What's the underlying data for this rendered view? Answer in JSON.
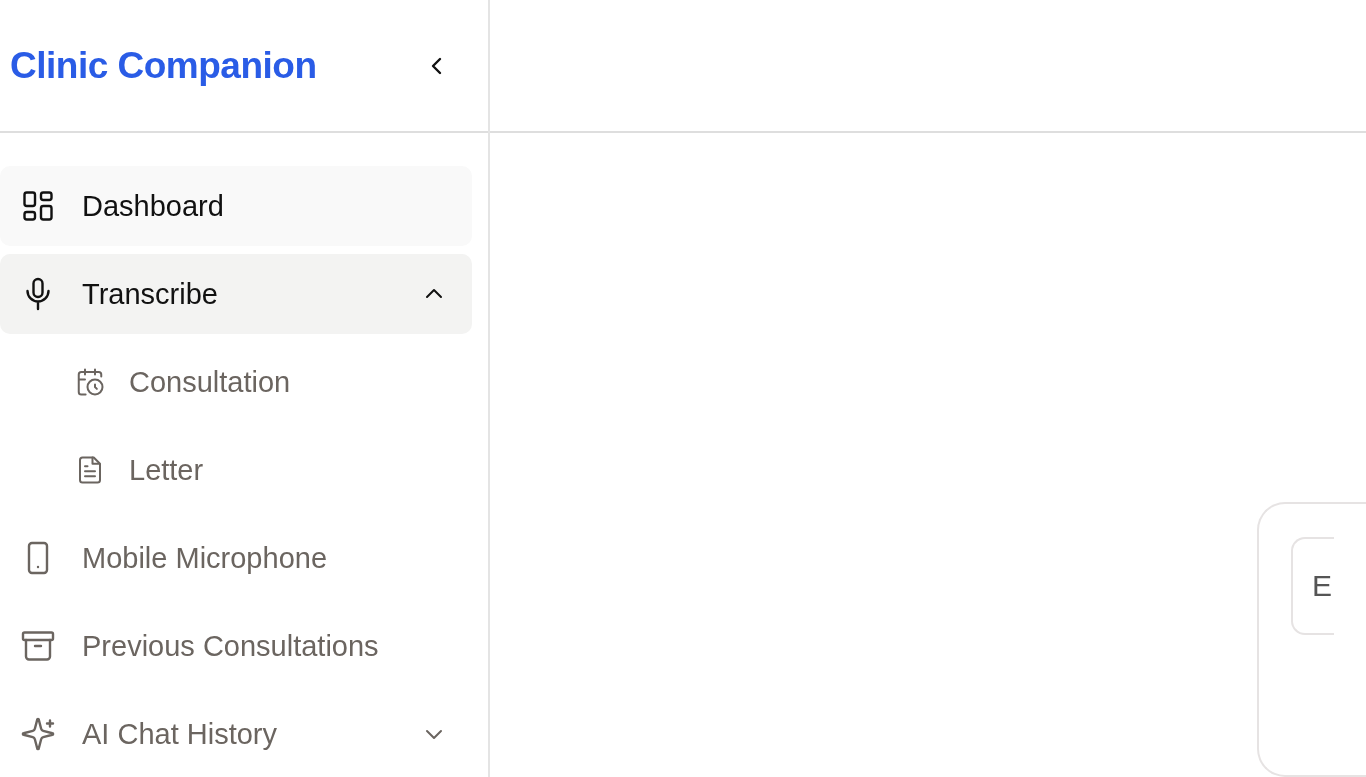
{
  "sidebar": {
    "title": "Clinic Companion",
    "items": [
      {
        "label": "Dashboard",
        "selected": true
      },
      {
        "label": "Transcribe",
        "selected": true,
        "expanded": true,
        "children": [
          {
            "label": "Consultation"
          },
          {
            "label": "Letter"
          }
        ]
      },
      {
        "label": "Mobile Microphone",
        "selected": false
      },
      {
        "label": "Previous Consultations",
        "selected": false
      },
      {
        "label": "AI Chat History",
        "selected": false,
        "expanded": false
      }
    ]
  },
  "main": {
    "card": {
      "button_label": "E"
    }
  }
}
